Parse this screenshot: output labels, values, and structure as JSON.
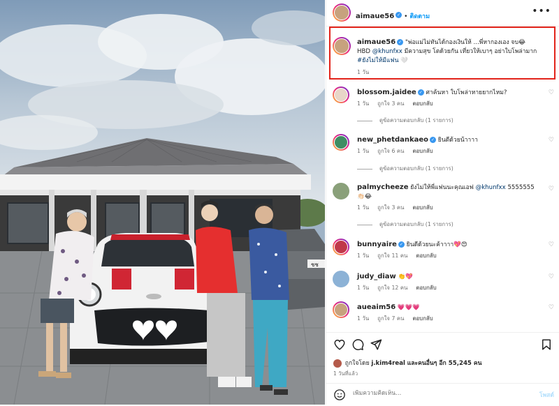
{
  "header": {
    "username": "aimaue56",
    "separator": "•",
    "follow_label": "ติดตาม",
    "more_label": "•••"
  },
  "caption": {
    "username": "aimaue56",
    "text_part1": "\"พ่อแม่ไม่ทันได้กองเงินให้ ...พี่หากองเอง จบ😂",
    "text_part2": "HBD",
    "mention": "@khunfxx",
    "text_part3": "มีความสุข โตด้วยกัน เที่ยวให้เบาๆ อย่าใบโพล่ามาก",
    "hashtag": "#ยังไม่ให้มีแฟน",
    "end_emoji": "🤍",
    "time": "1 วัน"
  },
  "comments": [
    {
      "username": "blossom.jaidee",
      "verified": true,
      "text": "ศาค้นหา ใบโพล่าหายยากไหม?",
      "time": "1 วัน",
      "likes": "ถูกใจ 3 คน",
      "reply": "ตอบกลับ",
      "view_replies": "ดูข้อความตอบกลับ (1 รายการ)"
    },
    {
      "username": "new_phetdankaeo",
      "verified": true,
      "text": "ยินดีด้วยน้าาาา",
      "time": "1 วัน",
      "likes": "ถูกใจ 6 คน",
      "reply": "ตอบกลับ",
      "view_replies": "ดูข้อความตอบกลับ (1 รายการ)"
    },
    {
      "username": "palmycheeze",
      "verified": false,
      "text": "ยังไม่ให้พี่แฟนนะคุณเอฟ",
      "mention": "@khunfxx",
      "text_after": "5555555 👏🏻😂",
      "time": "1 วัน",
      "likes": "ถูกใจ 3 คน",
      "reply": "ตอบกลับ",
      "view_replies": "ดูข้อความตอบกลับ (1 รายการ)"
    },
    {
      "username": "bunnyaire",
      "verified": true,
      "text": "ยินดีด้วยนะค้าาาา💖😍",
      "time": "1 วัน",
      "likes": "ถูกใจ 11 คน",
      "reply": "ตอบกลับ"
    },
    {
      "username": "judy_diaw",
      "verified": false,
      "text": "👏💖",
      "time": "1 วัน",
      "likes": "ถูกใจ 12 คน",
      "reply": "ตอบกลับ"
    },
    {
      "username": "aueaim56",
      "verified": false,
      "text": "💗💗💗",
      "time": "1 วัน",
      "likes": "ถูกใจ 7 คน",
      "reply": "ตอบกลับ"
    }
  ],
  "footer": {
    "liked_by_prefix": "ถูกใจโดย",
    "liked_by_user": "j.kim4real",
    "liked_by_suffix": "และคนอื่นๆ อีก 55,245 คน",
    "when": "1 วันที่แล้ว",
    "add_comment_placeholder": "เพิ่มความคิดเห็น...",
    "post_label": "โพสต์"
  },
  "photo": {
    "license_plate": "ชช"
  }
}
